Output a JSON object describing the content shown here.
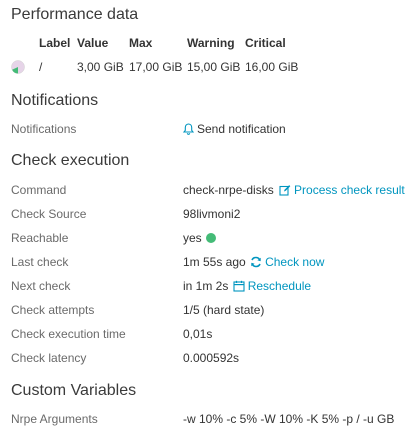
{
  "colors": {
    "link": "#0095bf",
    "ok": "#44bb77",
    "label": "#6a6a6a"
  },
  "performance": {
    "title": "Performance data",
    "headers": {
      "label": "Label",
      "value": "Value",
      "max": "Max",
      "warning": "Warning",
      "critical": "Critical"
    },
    "rows": [
      {
        "label": "/",
        "value": "3,00 GiB",
        "max": "17,00 GiB",
        "warning": "15,00 GiB",
        "critical": "16,00 GiB",
        "usage_fraction": 0.18
      }
    ]
  },
  "notifications": {
    "title": "Notifications",
    "label": "Notifications",
    "action": "Send notification"
  },
  "check_execution": {
    "title": "Check execution",
    "command_label": "Command",
    "command_value": "check-nrpe-disks",
    "command_action": "Process check result",
    "source_label": "Check Source",
    "source_value": "98livmoni2",
    "reachable_label": "Reachable",
    "reachable_value": "yes",
    "last_check_label": "Last check",
    "last_check_value": "1m 55s ago",
    "last_check_action": "Check now",
    "next_check_label": "Next check",
    "next_check_value": "in 1m 2s",
    "next_check_action": "Reschedule",
    "attempts_label": "Check attempts",
    "attempts_value": "1/5 (hard state)",
    "exec_time_label": "Check execution time",
    "exec_time_value": "0,01s",
    "latency_label": "Check latency",
    "latency_value": "0.000592s"
  },
  "custom_variables": {
    "title": "Custom Variables",
    "nrpe_label": "Nrpe Arguments",
    "nrpe_value": "-w 10% -c 5% -W 10% -K 5% -p / -u GB"
  }
}
